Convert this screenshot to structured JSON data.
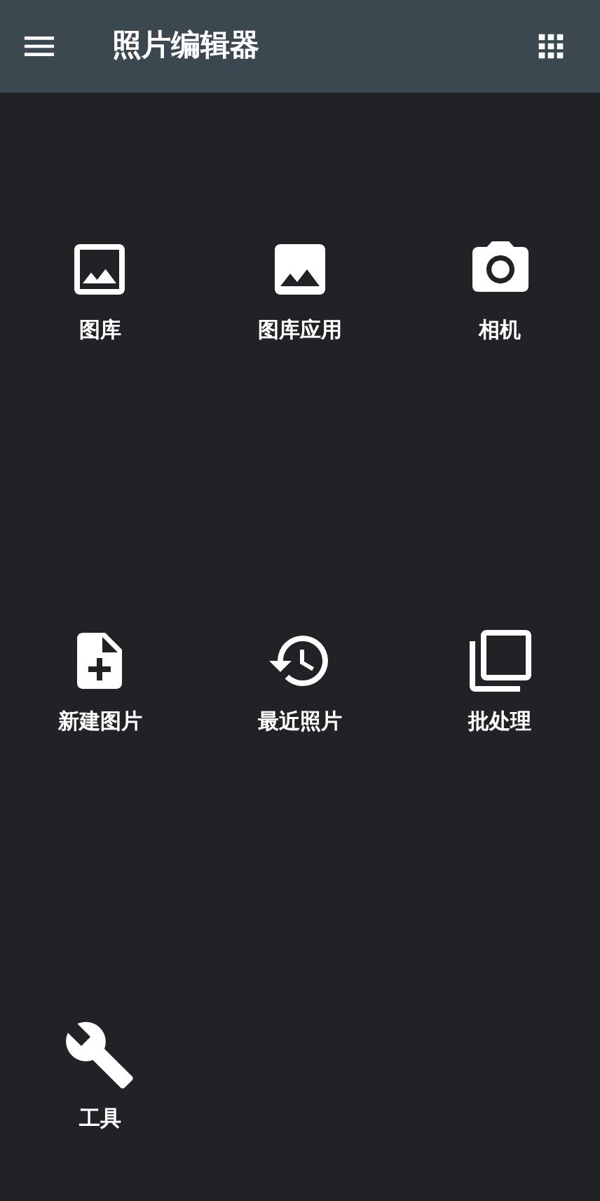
{
  "app_bar": {
    "title": "照片编辑器"
  },
  "tiles": [
    {
      "label": "图库"
    },
    {
      "label": "图库应用"
    },
    {
      "label": "相机"
    },
    {
      "label": "新建图片"
    },
    {
      "label": "最近照片"
    },
    {
      "label": "批处理"
    },
    {
      "label": "工具"
    }
  ]
}
